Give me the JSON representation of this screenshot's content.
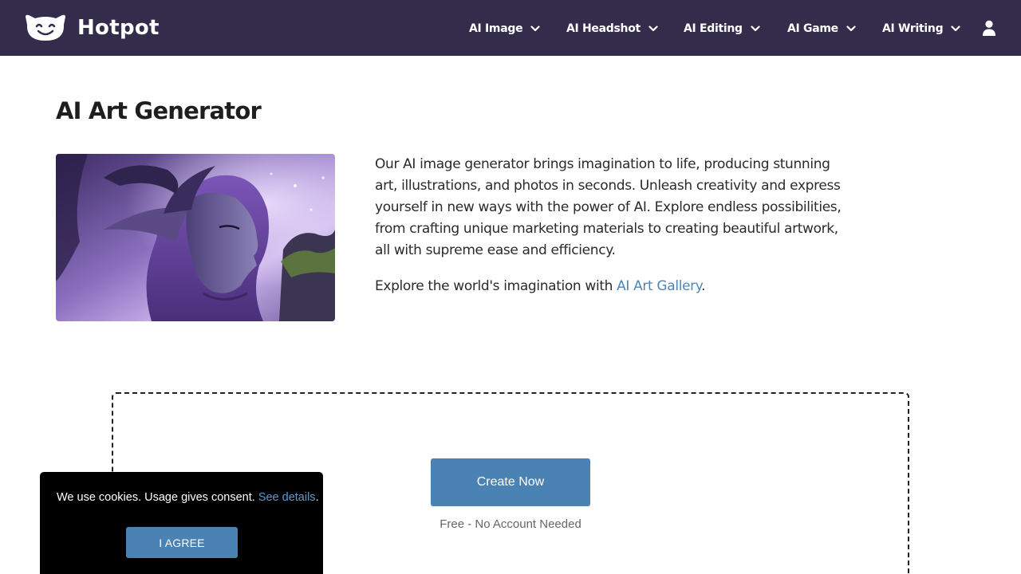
{
  "header": {
    "brand_name": "Hotpot",
    "background_color": "#332c4b",
    "nav": [
      {
        "label": "AI Image",
        "icon": "chevron-down-icon"
      },
      {
        "label": "AI Headshot",
        "icon": "chevron-down-icon"
      },
      {
        "label": "AI Editing",
        "icon": "chevron-down-icon"
      },
      {
        "label": "AI Game",
        "icon": "chevron-down-icon"
      },
      {
        "label": "AI Writing",
        "icon": "chevron-down-icon"
      }
    ],
    "account_icon": "user-icon"
  },
  "main": {
    "title": "AI Art Generator",
    "hero_image": "fantasy-elf-portrait",
    "intro_paragraph": "Our AI image generator brings imagination to life, producing stunning art, illustrations, and photos in seconds. Unleash creativity and express yourself in new ways with the power of AI. Explore endless possibilities, from crafting unique marketing materials to creating beautiful artwork, all with supreme ease and efficiency.",
    "gallery_prefix": "Explore the world's imagination with ",
    "gallery_link": "AI Art Gallery",
    "gallery_suffix": ".",
    "link_color": "#4d86b5"
  },
  "create": {
    "button_label": "Create Now",
    "subtext": "Free - No Account Needed",
    "button_color": "#4a82b4"
  },
  "cookie": {
    "text": "We use cookies. Usage gives consent. ",
    "link": "See details",
    "suffix": ".",
    "agree_label": "I AGREE"
  }
}
